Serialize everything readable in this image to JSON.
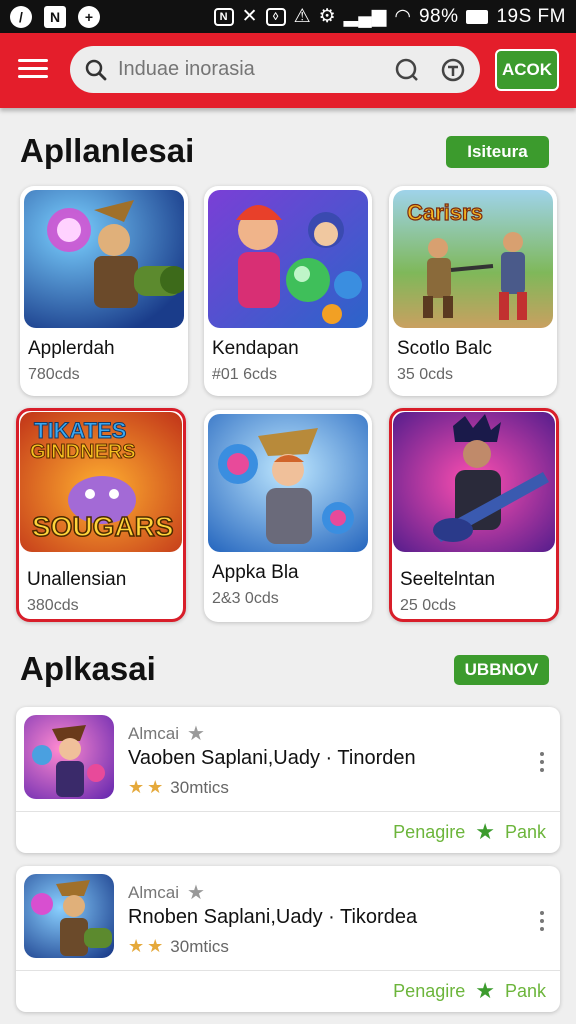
{
  "status_bar": {
    "battery": "98%",
    "time": "19S FM"
  },
  "header": {
    "search": {
      "placeholder": "Induae inorasia"
    },
    "action_label": "ACOK"
  },
  "section1": {
    "title": "Apllanlesai",
    "action_label": "Isiteura",
    "cards": [
      {
        "name": "Applerdah",
        "count": "780cds"
      },
      {
        "name": "Kendapan",
        "count": "#01 6cds"
      },
      {
        "name": "Scotlo Balc",
        "count": "35 0cds"
      },
      {
        "name": "Unallensian",
        "count": "380cds"
      },
      {
        "name": "Appka Bla",
        "count": "2&3 0cds"
      },
      {
        "name": "Seeltelntan",
        "count": "25 0cds"
      }
    ],
    "art_text": {
      "card3": "Carisrs",
      "card4_top": "TIKATES",
      "card4_mid": "GINDNERS",
      "card4_bottom": "SOUGARS"
    }
  },
  "section2": {
    "title": "Aplkasai",
    "action_label": "UBBNOV",
    "items": [
      {
        "category": "Almcai",
        "title": "Vaoben Saplani,Uady · Tinorden",
        "rating": "30mtics",
        "action1": "Penagire",
        "action2": "Pank"
      },
      {
        "category": "Almcai",
        "title": "Rnoben Saplani,Uady · Tikordea",
        "rating": "30mtics",
        "action1": "Penagire",
        "action2": "Pank"
      }
    ]
  },
  "colors": {
    "brand_red": "#e41e2b",
    "accent_green": "#3c9b2d",
    "link_green": "#6cb53b",
    "star_gold": "#e5a93b"
  }
}
